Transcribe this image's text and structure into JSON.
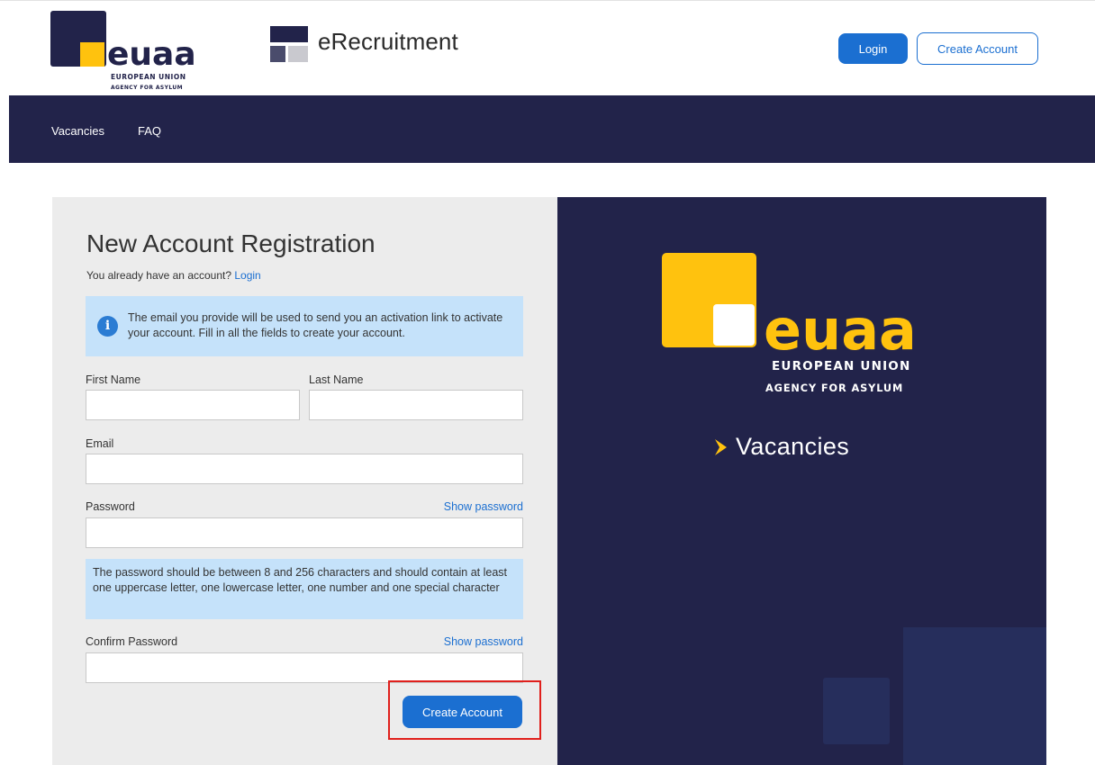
{
  "header": {
    "logo": {
      "wordmark": "euaa",
      "line1": "EUROPEAN UNION",
      "line2": "AGENCY FOR ASYLUM"
    },
    "app_title": "eRecruitment",
    "login_label": "Login",
    "create_account_label": "Create Account"
  },
  "nav": {
    "items": [
      {
        "label": "Vacancies"
      },
      {
        "label": "FAQ"
      }
    ]
  },
  "form": {
    "title": "New Account Registration",
    "already_text": "You already have an account?",
    "already_link": "Login",
    "info_text": "The email you provide will be used to send you an activation link to activate your account. Fill in all the fields to create your account.",
    "first_name_label": "First Name",
    "first_name_value": "",
    "last_name_label": "Last Name",
    "last_name_value": "",
    "email_label": "Email",
    "email_value": "",
    "password_label": "Password",
    "password_value": "",
    "show_password_label": "Show password",
    "password_hint": "The password should be between 8 and 256 characters and should contain at least one uppercase letter, one lowercase letter, one number and one special character",
    "confirm_password_label": "Confirm Password",
    "confirm_password_value": "",
    "show_confirm_password_label": "Show password",
    "submit_label": "Create Account"
  },
  "brand_panel": {
    "logo": {
      "wordmark": "euaa",
      "line1": "EUROPEAN UNION",
      "line2": "AGENCY FOR ASYLUM"
    },
    "section_label": "Vacancies"
  },
  "colors": {
    "navy": "#22234a",
    "brand_yellow": "#ffc20e",
    "primary_blue": "#1b6fd1",
    "info_bg": "#c5e2fa",
    "highlight_red": "#e0201c"
  }
}
